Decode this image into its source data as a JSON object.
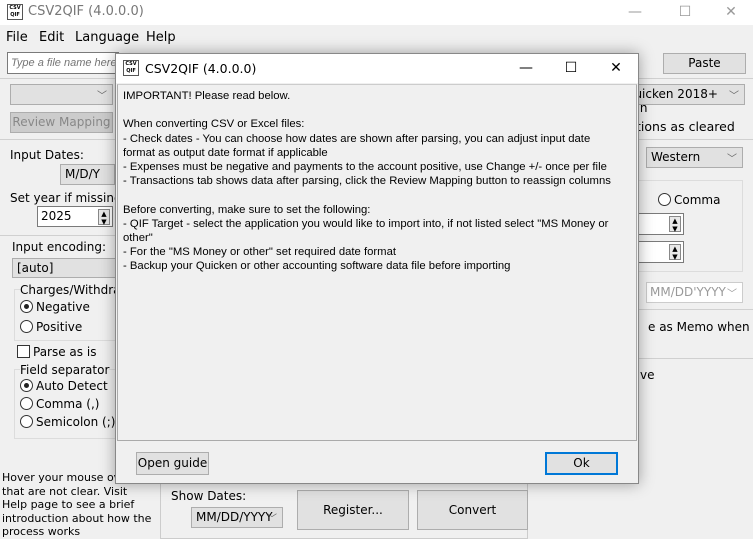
{
  "window": {
    "title": "CSV2QIF (4.0.0.0)",
    "icon_text": "CSV QIF",
    "minimize": "—",
    "maximize": "☐",
    "close": "✕"
  },
  "menu": [
    "File",
    "Edit",
    "Language",
    "Help"
  ],
  "main": {
    "file_placeholder": "Type a file name here",
    "paste_label": "Paste",
    "review_mapping_label": "Review Mapping",
    "qif_target": "Quicken 2018+ Win",
    "input_dates_label": "Input Dates:",
    "input_dates_value": "M/D/Y",
    "set_year_label": "Set year if missing:",
    "year_value": "2025",
    "encoding_label": "Input encoding:",
    "encoding_value": "[auto]",
    "charges_group": "Charges/Withdrawals",
    "negative_label": "Negative",
    "positive_label": "Positive",
    "parse_as_is_label": "Parse as is",
    "field_sep_group": "Field separator",
    "auto_detect_label": "Auto Detect",
    "comma_sep_label": "Comma (,)",
    "semicolon_label": "Semicolon (;)",
    "cleared_text": "tions as cleared",
    "number_format": "Western",
    "decimal_comma_label": "Comma",
    "date_format_disabled": "MM/DD'YYYY",
    "memo_text": "e as Memo when",
    "ve_text": "ve",
    "hover_help": "Hover your mouse over that are not clear. Visit Help page to see a brief introduction about how the process works",
    "show_dates_label": "Show Dates:",
    "show_dates_value": "MM/DD/YYYY",
    "register_label": "Register...",
    "convert_label": "Convert"
  },
  "dialog": {
    "title": "CSV2QIF (4.0.0.0)",
    "message": "IMPORTANT! Please read below.\n\nWhen converting CSV or Excel files:\n- Check dates - You can choose how dates are shown after parsing, you can adjust input date\nformat as output date format if applicable\n- Expenses must be negative and payments to the account positive, use Change +/- once per file\n- Transactions tab shows data after parsing, click the Review Mapping button to reassign columns\n\nBefore converting, make sure to set the following:\n- QIF Target - select the application you would like to import into, if not listed select \"MS Money or\nother\"\n- For the \"MS Money or other\" set required date format\n- Backup your Quicken or other accounting software data file before importing",
    "open_guide_label": "Open guide",
    "ok_label": "Ok"
  }
}
